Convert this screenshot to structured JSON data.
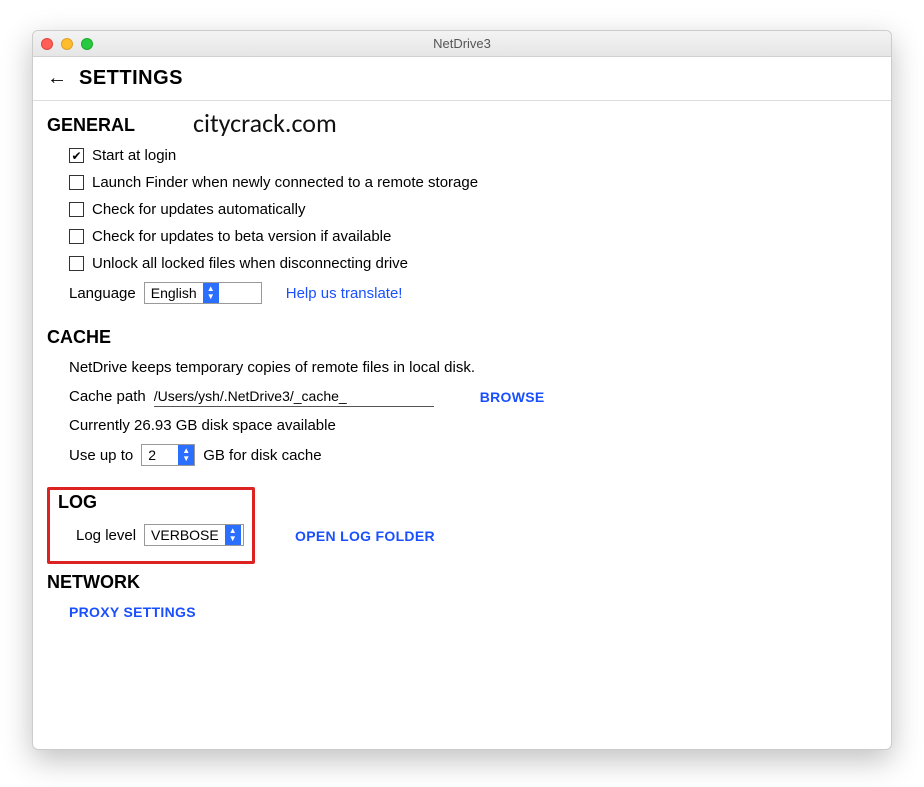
{
  "window": {
    "title": "NetDrive3"
  },
  "header": {
    "title": "SETTINGS"
  },
  "watermark": "citycrack.com",
  "general": {
    "title": "GENERAL",
    "start_at_login": "Start at login",
    "launch_finder": "Launch Finder when newly connected to a remote storage",
    "check_updates": "Check for updates automatically",
    "check_beta": "Check for updates to beta version if available",
    "unlock_files": "Unlock all locked files when disconnecting drive",
    "language_label": "Language",
    "language_value": "English",
    "translate_link": "Help us translate!"
  },
  "cache": {
    "title": "CACHE",
    "desc": "NetDrive keeps temporary copies of remote files in local disk.",
    "path_label": "Cache path",
    "path_value": "/Users/ysh/.NetDrive3/_cache_",
    "browse": "BROWSE",
    "space_available": "Currently 26.93 GB disk space available",
    "use_up_to": "Use up to",
    "gb_value": "2",
    "gb_suffix": "GB for disk cache"
  },
  "log": {
    "title": "LOG",
    "level_label": "Log level",
    "level_value": "VERBOSE",
    "open_folder": "OPEN LOG FOLDER"
  },
  "network": {
    "title": "NETWORK",
    "proxy": "PROXY SETTINGS"
  }
}
